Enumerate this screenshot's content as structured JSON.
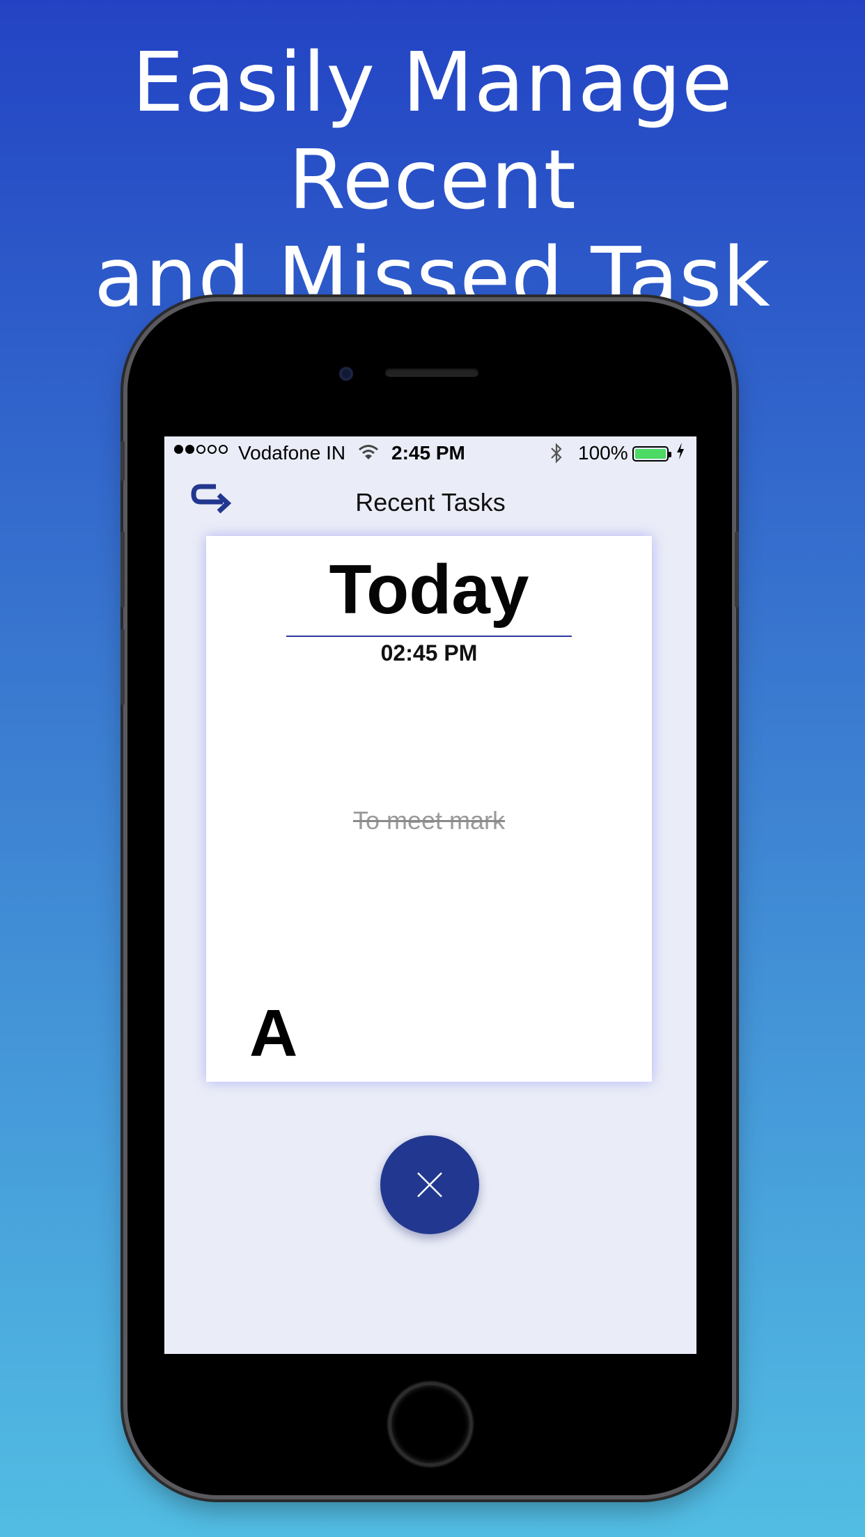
{
  "headline": {
    "line1": "Easily Manage Recent",
    "line2": "and Missed Task"
  },
  "status_bar": {
    "signal_strength": 2,
    "signal_total": 5,
    "carrier": "Vodafone IN",
    "time": "2:45 PM",
    "battery_percent": "100%",
    "battery_level": 1.0,
    "icons": [
      "wifi-icon",
      "bluetooth-icon",
      "battery-icon",
      "charging-icon"
    ]
  },
  "nav": {
    "title": "Recent Tasks",
    "back_icon": "return-arrow-icon"
  },
  "task_card": {
    "day": "Today",
    "time": "02:45 PM",
    "task": "To meet mark",
    "completed": true,
    "label": "A"
  },
  "actions": {
    "close_icon": "close-icon"
  },
  "colors": {
    "accent": "#22378f",
    "card_glow": "#6e6ef5",
    "battery": "#4cd964",
    "screen_bg": "#eaedf7",
    "gradient_top": "#2343c4",
    "gradient_bottom": "#52bde3"
  }
}
